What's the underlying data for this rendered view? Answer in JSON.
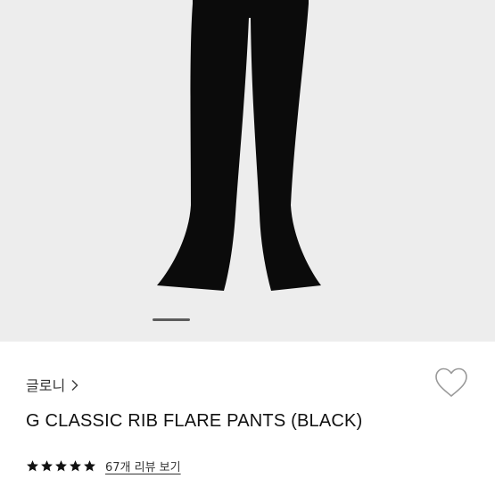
{
  "product": {
    "image_icon": "flare-pants-photo",
    "image_background": "#ededed",
    "gallery": {
      "current": 1
    },
    "brand": "글로니",
    "brand_chevron": "chevron-right-icon",
    "favorite_icon": "heart-outline-icon",
    "title": "G CLASSIC RIB FLARE PANTS (BLACK)",
    "rating": {
      "stars": 5,
      "star_color": "#111111"
    },
    "review_link": "67개 리뷰 보기"
  }
}
